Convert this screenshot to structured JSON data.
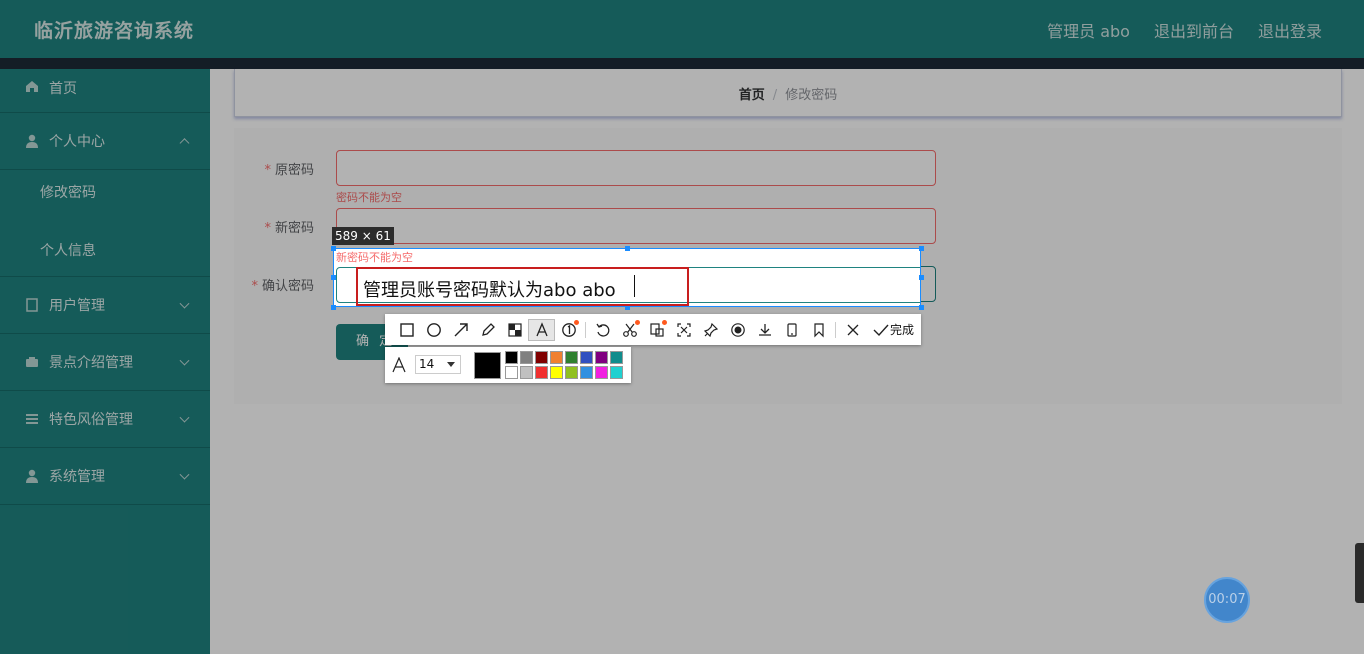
{
  "header": {
    "app_title": "临沂旅游咨询系统",
    "user_link": "管理员 abo",
    "front_link": "退出到前台",
    "logout_link": "退出登录"
  },
  "sidebar": {
    "home": "首页",
    "personal_center": "个人中心",
    "change_password": "修改密码",
    "personal_info": "个人信息",
    "user_management": "用户管理",
    "scenic_management": "景点介绍管理",
    "custom_management": "特色风俗管理",
    "system_management": "系统管理"
  },
  "breadcrumb": {
    "home": "首页",
    "separator": "/",
    "current": "修改密码"
  },
  "form": {
    "old_password_label": "原密码",
    "old_password_error": "密码不能为空",
    "new_password_label": "新密码",
    "new_password_error": "新密码不能为空",
    "confirm_password_label": "确认密码",
    "required_mark": "*",
    "submit_label": "确 定"
  },
  "capture_tool": {
    "selection_size": "589 × 61",
    "text_annotation": "管理员账号密码默认为abo abo",
    "done_label": "完成",
    "font_size": "14",
    "current_color": "#000000",
    "swatches": [
      "#000000",
      "#808080",
      "#800000",
      "#f08030",
      "#308030",
      "#3050c0",
      "#800080",
      "#108c8c",
      "#ffffff",
      "#c0c0c0",
      "#f03030",
      "#ffff00",
      "#90c020",
      "#3090e0",
      "#f020e0",
      "#20d0d0"
    ]
  },
  "timer": {
    "value": "00:07"
  }
}
